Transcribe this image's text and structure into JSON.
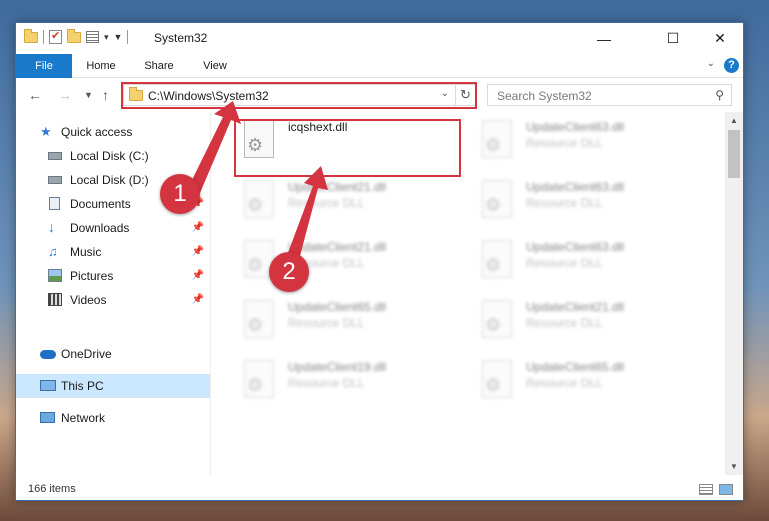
{
  "window": {
    "title": "System32",
    "controls": {
      "minimize": "—",
      "maximize": "☐",
      "close": "✕"
    }
  },
  "ribbon": {
    "tabs": [
      {
        "label": "File"
      },
      {
        "label": "Home"
      },
      {
        "label": "Share"
      },
      {
        "label": "View"
      }
    ],
    "help": "?"
  },
  "address_bar": {
    "path": "C:\\Windows\\System32"
  },
  "search": {
    "placeholder": "Search System32"
  },
  "sidebar": {
    "items": [
      {
        "label": "Quick access",
        "icon": "star-icon"
      },
      {
        "label": "Local Disk (C:)",
        "icon": "drive-icon"
      },
      {
        "label": "Local Disk (D:)",
        "icon": "drive-icon"
      },
      {
        "label": "Documents",
        "icon": "documents-icon"
      },
      {
        "label": "Downloads",
        "icon": "download-icon"
      },
      {
        "label": "Music",
        "icon": "music-icon"
      },
      {
        "label": "Pictures",
        "icon": "pictures-icon"
      },
      {
        "label": "Videos",
        "icon": "videos-icon"
      },
      {
        "label": "OneDrive",
        "icon": "cloud-icon"
      },
      {
        "label": "This PC",
        "icon": "computer-icon",
        "selected": true
      },
      {
        "label": "Network",
        "icon": "network-icon"
      }
    ]
  },
  "files": [
    {
      "name": "icqshext.dll",
      "type": "",
      "highlighted": true
    },
    {
      "name": "UpdateClient63.dll",
      "type": "Resource DLL"
    },
    {
      "name": "UpdateClient21.dll",
      "type": "Resource DLL"
    },
    {
      "name": "UpdateClient63.dll",
      "type": "Resource DLL"
    },
    {
      "name": "UpdateClient21.dll",
      "type": "Resource DLL"
    },
    {
      "name": "UpdateClient63.dll",
      "type": "Resource DLL"
    },
    {
      "name": "UpdateClient65.dll",
      "type": "Resource DLL"
    },
    {
      "name": "UpdateClient21.dll",
      "type": "Resource DLL"
    },
    {
      "name": "UpdateClient19.dll",
      "type": "Resource DLL"
    },
    {
      "name": "UpdateClient65.dll",
      "type": "Resource DLL"
    }
  ],
  "status": {
    "items_count": "166 items"
  },
  "annotations": {
    "step1": "1",
    "step2": "2",
    "color": "#d3343f"
  }
}
